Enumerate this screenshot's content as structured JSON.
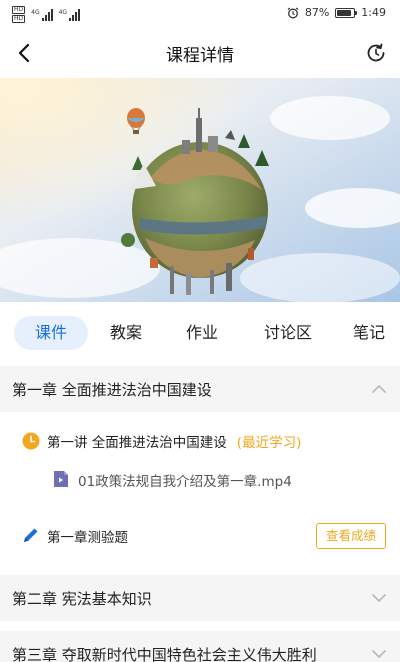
{
  "status_bar": {
    "hd_label": "HD",
    "network_label": "4G",
    "battery": "87%",
    "time": "1:49",
    "battery_level": 0.87
  },
  "header": {
    "title": "课程详情"
  },
  "tabs": [
    {
      "label": "课件",
      "active": true
    },
    {
      "label": "教案",
      "active": false
    },
    {
      "label": "作业",
      "active": false
    },
    {
      "label": "讨论区",
      "active": false
    },
    {
      "label": "笔记",
      "active": false
    }
  ],
  "chapters": [
    {
      "title": "第一章 全面推进法治中国建设",
      "expanded": true,
      "lesson": {
        "title": "第一讲 全面推进法治中国建设",
        "tag": "(最近学习)",
        "file": "01政策法规自我介绍及第一章.mp4"
      },
      "quiz": {
        "title": "第一章测验题",
        "button": "查看成绩"
      }
    },
    {
      "title": "第二章 宪法基本知识",
      "expanded": false
    },
    {
      "title": "第三章 夺取新时代中国特色社会主义伟大胜利",
      "expanded": false
    }
  ],
  "colors": {
    "accent_blue": "#1a6fe0",
    "tab_bg": "#e6f0fc",
    "orange": "#f2a71f",
    "chapter_bg": "#f5f5f5"
  }
}
